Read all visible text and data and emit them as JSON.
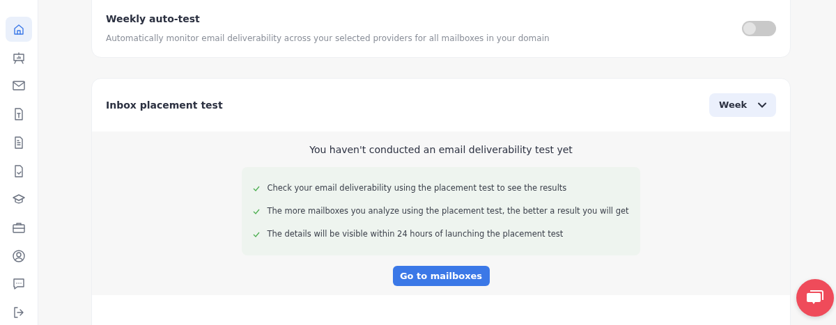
{
  "sidebar": {
    "items": [
      {
        "kind": "home",
        "selected": true
      },
      {
        "kind": "presentation",
        "selected": false
      },
      {
        "kind": "mail",
        "selected": false
      },
      {
        "kind": "text-file",
        "selected": false
      },
      {
        "kind": "document",
        "selected": false
      },
      {
        "kind": "checked-file",
        "selected": false
      },
      {
        "kind": "graduation",
        "selected": false
      },
      {
        "kind": "briefcase",
        "selected": false
      },
      {
        "kind": "user",
        "selected": false
      },
      {
        "kind": "chat",
        "selected": false
      },
      {
        "kind": "logout",
        "selected": false
      }
    ]
  },
  "auto_test": {
    "title": "Weekly auto-test",
    "description": "Automatically monitor email deliverability across your selected providers for all mailboxes in your domain",
    "on": false
  },
  "placement_test": {
    "title": "Inbox placement test",
    "period": {
      "value": "Week"
    },
    "empty_state": {
      "heading": "You haven't conducted an email deliverability test yet",
      "tips": [
        "Check your email deliverability using the placement test to see the results",
        "The more mailboxes you analyze using the placement test, the better a result you will get",
        "The details will be visible within 24 hours of launching the placement test"
      ],
      "button": "Go to mailboxes"
    }
  }
}
